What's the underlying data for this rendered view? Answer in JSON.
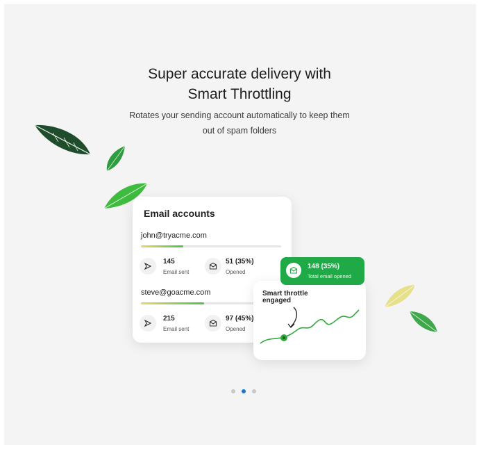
{
  "hero": {
    "title_line1": "Super accurate delivery with",
    "title_line2": "Smart Throttling",
    "subtitle_line1": "Rotates your sending account automatically to keep them",
    "subtitle_line2": "out of spam folders"
  },
  "accounts_card": {
    "title": "Email accounts",
    "accounts": [
      {
        "email": "john@tryacme.com",
        "progress": 0.3,
        "sent_value": "145",
        "sent_label": "Email sent",
        "opened_value": "51 (35%)",
        "opened_label": "Opened"
      },
      {
        "email": "steve@goacme.com",
        "progress": 0.45,
        "sent_value": "215",
        "sent_label": "Email sent",
        "opened_value": "97 (45%)",
        "opened_label": "Opened"
      }
    ]
  },
  "total_badge": {
    "value": "148 (35%)",
    "label": "Total email opened"
  },
  "throttle_card": {
    "line1": "Smart throttle",
    "line2": "engaged"
  },
  "carousel": {
    "dot_count": 3,
    "active_index": 1
  },
  "colors": {
    "brand_green": "#1faa47",
    "active_dot": "#1976d2",
    "inactive_dot": "#c8c8c8",
    "dark_leaf": "#1f4d2b"
  },
  "icons": [
    "send-icon",
    "envelope-open-icon",
    "leaf-icon"
  ]
}
